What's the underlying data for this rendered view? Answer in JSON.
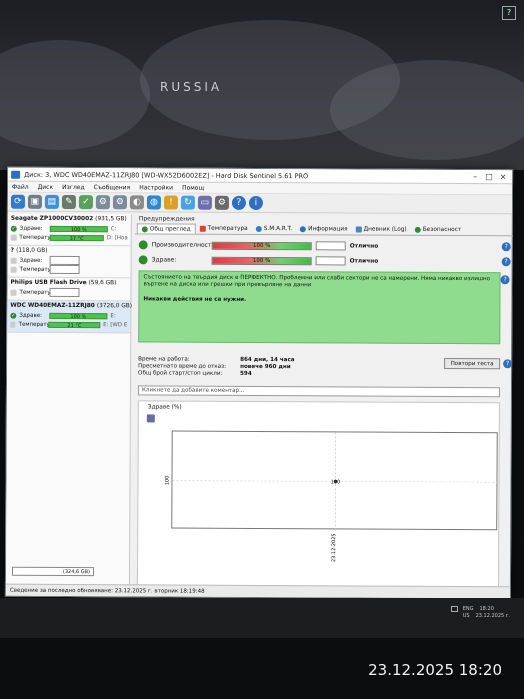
{
  "background": {
    "map_label": "RUSSIA",
    "corner_tag": "?"
  },
  "window": {
    "title": "Диск: 3, WDC WD40EMAZ-11ZRJ80 [WD-WX52D6002EZ] - Hard Disk Sentinel 5.61 PRO",
    "controls": [
      "–",
      "□",
      "×"
    ]
  },
  "menu": [
    "Файл",
    "Диск",
    "Изглед",
    "Съобщения",
    "Настройки",
    "Помощ"
  ],
  "toolbar_icons": [
    "refresh-icon",
    "disk-icon",
    "report-icon",
    "tools-icon",
    "test-icon",
    "test2-icon",
    "test3-icon",
    "surface-icon",
    "globe-icon",
    "alert-icon",
    "sync-icon",
    "save-icon",
    "settings-icon",
    "help-icon",
    "info-icon"
  ],
  "disks": [
    {
      "name": "Seagate ZP1000CV30002",
      "size": "(931,5 GB)",
      "health_label": "Здраве:",
      "health_value": "100 %",
      "health_vol": "C:",
      "temp_label": "Температура:",
      "temp_value": "37 °C",
      "temp_vol": "D: [Hoa",
      "selected": false
    },
    {
      "name": "?",
      "size": "(118,0 GB)",
      "health_label": "Здраве:",
      "health_value": "",
      "health_vol": "",
      "temp_label": "Температура:",
      "temp_value": "",
      "temp_vol": "",
      "selected": false
    },
    {
      "name": "Philips USB Flash Drive",
      "size": "(59,6 GB)",
      "health_label": "Температура:",
      "health_value": "",
      "health_vol": "",
      "temp_label": "",
      "temp_value": "",
      "temp_vol": "",
      "selected": false
    },
    {
      "name": "WDC WD40EMAZ-11ZRJ80",
      "size": "(3726,0 GB)",
      "health_label": "Здраве:",
      "health_value": "100 %",
      "health_vol": "E:",
      "temp_label": "Температура:",
      "temp_value": "21 °C",
      "temp_vol": "E: [WD E",
      "selected": true
    }
  ],
  "left_bottom_size": "(324,6 GB)",
  "warnings_label": "Предупреждения",
  "tabs": [
    "Общ преглед",
    "Температура",
    "S.M.A.R.T.",
    "Информация",
    "Дневник (Log)",
    "Безопасност"
  ],
  "performance": {
    "label": "Производителност:",
    "value": "100 %",
    "status": "Отлично"
  },
  "health": {
    "label": "Здраве:",
    "value": "100 %",
    "status": "Отлично"
  },
  "message": {
    "text": "Състоянието на твърдия диск е ПЕРФЕКТНО. Проблемни или слаби сектори не са намерени. Няма никакво излишно въртене на диска или грешки при превърляне на данни",
    "action": "Никакви действия не са нужни."
  },
  "stats": [
    {
      "key": "Време на работа:",
      "value": "864 дни, 14 часа"
    },
    {
      "key": "Пресметнато време до отказ:",
      "value": "повече 960 дни"
    },
    {
      "key": "Общ брой старт/стоп цикли:",
      "value": "594"
    }
  ],
  "retest_button": "Повтори теста",
  "comment_placeholder": "Кликнете да добавите коментар...",
  "chart_data": {
    "type": "line",
    "title": "Здраве (%)",
    "x": [
      "23.12.2025"
    ],
    "series": [
      {
        "values": [
          100
        ]
      }
    ],
    "ylabel": "",
    "y_tick": "100",
    "point_label": "100",
    "x_tick": "23.12.2025"
  },
  "statusbar": "Сведение за последно обновяване: 23.12.2025 г. вторник 18:19:48",
  "tray": {
    "lang1": "ENG",
    "lang2": "US",
    "time": "18:20",
    "date": "23.12.2025 г."
  },
  "photo_timestamp": "23.12.2025 18:20"
}
